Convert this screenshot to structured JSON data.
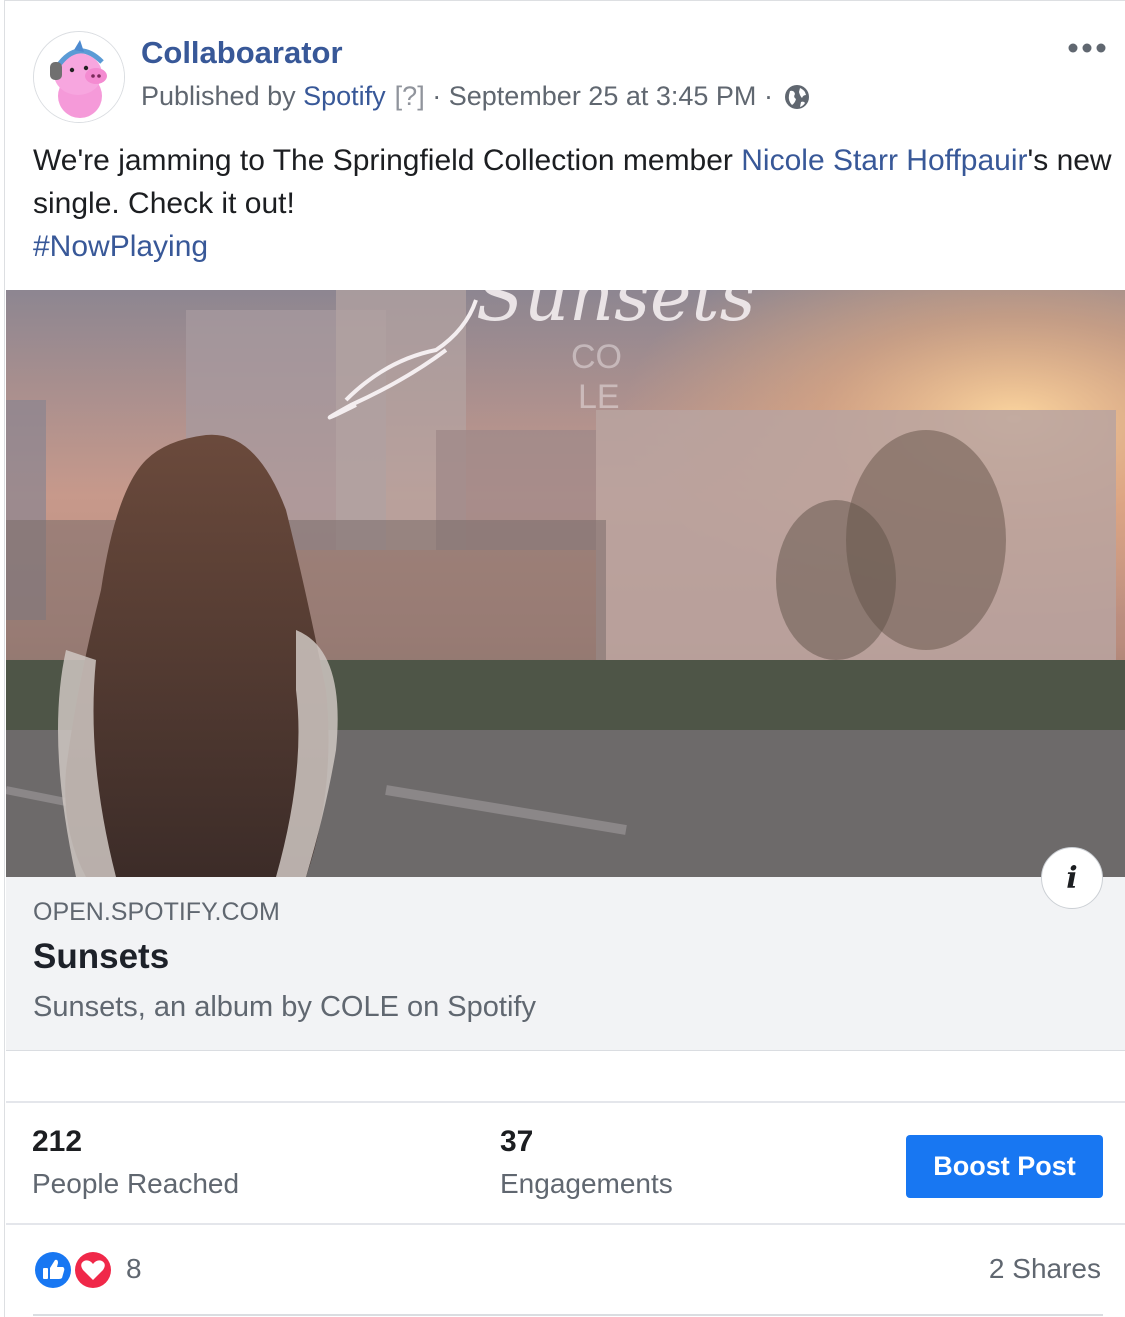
{
  "post": {
    "page_name": "Collaboarator",
    "meta": {
      "published_by_label": "Published by",
      "publisher": "Spotify",
      "help_marker": "[?]",
      "separator": "·",
      "timestamp": "September 25 at 3:45 PM",
      "audience_icon": "globe-icon"
    },
    "more_icon": "more-options-icon",
    "text": {
      "part1": "We're jamming to The Springfield Collection member ",
      "mention": "Nicole Starr Hoffpauir",
      "part2": "'s new single. Check it out!",
      "hashtag": "#NowPlaying"
    }
  },
  "link_preview": {
    "image_lettering": "Sunsets",
    "image_artist_lettering": "COLE",
    "domain": "OPEN.SPOTIFY.COM",
    "title": "Sunsets",
    "description": "Sunsets, an album by COLE on Spotify",
    "info_icon_glyph": "i"
  },
  "insights": {
    "people_reached_value": "212",
    "people_reached_label": "People Reached",
    "engagements_value": "37",
    "engagements_label": "Engagements",
    "boost_label": "Boost Post"
  },
  "footer": {
    "reaction_icons": [
      "like-icon",
      "love-icon"
    ],
    "reaction_count": "8",
    "shares": "2 Shares"
  },
  "colors": {
    "link": "#385898",
    "boost": "#1877f2",
    "secondary_text": "#606770"
  }
}
